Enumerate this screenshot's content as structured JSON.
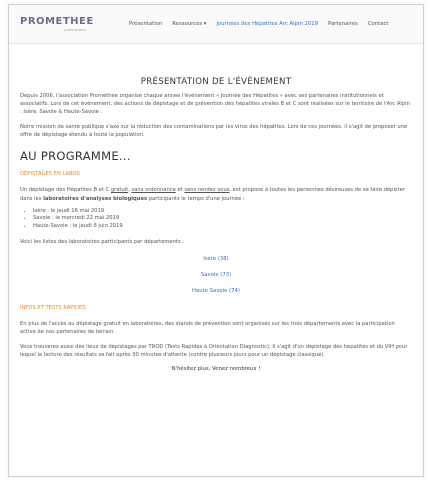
{
  "logo": {
    "text": "PROMETHEE",
    "tagline": "ALPES RÉSEAU"
  },
  "nav": {
    "items": [
      "Présentation",
      "Ressources ▾",
      "Journées des Hépatites Arc Alpin 2019",
      "Partenaires",
      "Contact"
    ]
  },
  "presentation": {
    "title": "PRÉSENTATION DE L'ÉVÈNEMENT",
    "p1": "Depuis 2006, l'association Prométhée organise chaque année l'évènement « Journée des Hépatites » avec ses partenaires institutionnels et associatifs. Lors de cet évènement, des actions de dépistage et de prévention des hépatites virales B et C sont réalisées sur le territoire de l'Arc Alpin : Isère, Savoie & Haute-Savoie .",
    "p2": "Notre mission de santé publique s'axe sur la réduction des contaminations par les virus des hépatites.  Lors de ces journées, il s'agit de proposer une offre de dépistage étendu à toute la population."
  },
  "programme": {
    "title": "AU PROGRAMME...",
    "labs": {
      "heading": "DÉPISTAGES EN LABOS",
      "intro_a": "Un dépistage des Hépatites B et C ",
      "gratuit": "gratuit",
      "comma1": ", ",
      "sans_ordo": "sans ordonnance",
      "et": " et ",
      "sans_rdv": "sans rendez vous",
      "intro_b": ", est proposé à toutes les personnes désireuses de se faire dépister dans les ",
      "labs_bold": "laboratoires d'analyses biologiques",
      "intro_c": " participants le temps d'une journée :",
      "dates": [
        "Isère : le jeudi 16 mai 2019",
        "Savoie : le mercredi 22 mai 2019",
        "Haute-Savoie : le jeudi 6 juin 2019"
      ],
      "list_intro": "Voici les listes des laboratoires participants par départements :",
      "links": [
        "Isère (38)",
        "Savoie (73)",
        "Haute Savoie (74)"
      ]
    },
    "infos": {
      "heading": "INFOS ET TESTS RAPIDES",
      "p1": "En plus de l'accès au dépistage gratuit en laboratoires, des stands de prévention sont organisés sur les trois départements avec la participation active de nos partenaires de terrain.",
      "p2": "Vous trouverez aussi des lieux de dépistages par TROD (Tests Rapides à Orientation Diagnostic). Il s'agit d'un dépistage des hépatites et du VIH pour lequel la lecture des résultats se fait après 30 minutes d'attente (contre plusieurs jours pour un dépistage classique).",
      "cta": "N'hésitez plus, Venez nombreux !"
    }
  },
  "colors": {
    "accent": "#e08a2e",
    "link": "#3a6fc0"
  }
}
